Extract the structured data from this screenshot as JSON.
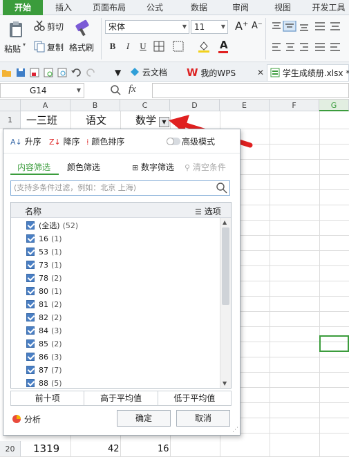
{
  "ribbon_tabs": [
    "开始",
    "插入",
    "页面布局",
    "公式",
    "数据",
    "审阅",
    "视图",
    "开发工具"
  ],
  "ribbon": {
    "paste_label": "粘贴",
    "cut_label": "剪切",
    "copy_label": "复制",
    "format_painter_label": "格式刷",
    "font_name": "宋体",
    "font_size": "11",
    "bold": "B",
    "italic": "I",
    "underline": "U",
    "font_color": "A"
  },
  "doc_tabs": {
    "cloud_docs": "云文档",
    "my_wps": "我的WPS",
    "file": "学生成绩册.xlsx *"
  },
  "formula_bar": {
    "cell_ref": "G14",
    "fx": "fx",
    "value": ""
  },
  "sheet": {
    "columns": [
      "A",
      "B",
      "C",
      "D",
      "E",
      "F",
      "G"
    ],
    "row1": {
      "num": "1",
      "a": "一三班",
      "b": "语文",
      "c": "数学"
    },
    "row20": {
      "num": "20",
      "a": "1319",
      "b": "42",
      "c": "16"
    }
  },
  "filter_popup": {
    "sort_asc": "升序",
    "sort_desc": "降序",
    "color_sort": "颜色排序",
    "advanced_mode": "高级模式",
    "tab_content": "内容筛选",
    "tab_color": "颜色筛选",
    "number_filter": "数字筛选",
    "clear_filter": "清空条件",
    "search_placeholder": "(支持多条件过滤，例如：北京 上海)",
    "list_header": "名称",
    "options": "选项",
    "items": [
      {
        "label": "(全选)",
        "count": "(52)"
      },
      {
        "label": "16",
        "count": "(1)"
      },
      {
        "label": "53",
        "count": "(1)"
      },
      {
        "label": "73",
        "count": "(1)"
      },
      {
        "label": "78",
        "count": "(2)"
      },
      {
        "label": "80",
        "count": "(1)"
      },
      {
        "label": "81",
        "count": "(2)"
      },
      {
        "label": "82",
        "count": "(2)"
      },
      {
        "label": "84",
        "count": "(3)"
      },
      {
        "label": "85",
        "count": "(2)"
      },
      {
        "label": "86",
        "count": "(3)"
      },
      {
        "label": "87",
        "count": "(7)"
      },
      {
        "label": "88",
        "count": "(5)"
      }
    ],
    "top10": "前十项",
    "above_avg": "高于平均值",
    "below_avg": "低于平均值",
    "analysis": "分析",
    "ok": "确定",
    "cancel": "取消"
  },
  "colors": {
    "accent_green": "#3b9c3c",
    "arrow_red": "#e02020",
    "checkbox_blue": "#4a7fc4"
  }
}
